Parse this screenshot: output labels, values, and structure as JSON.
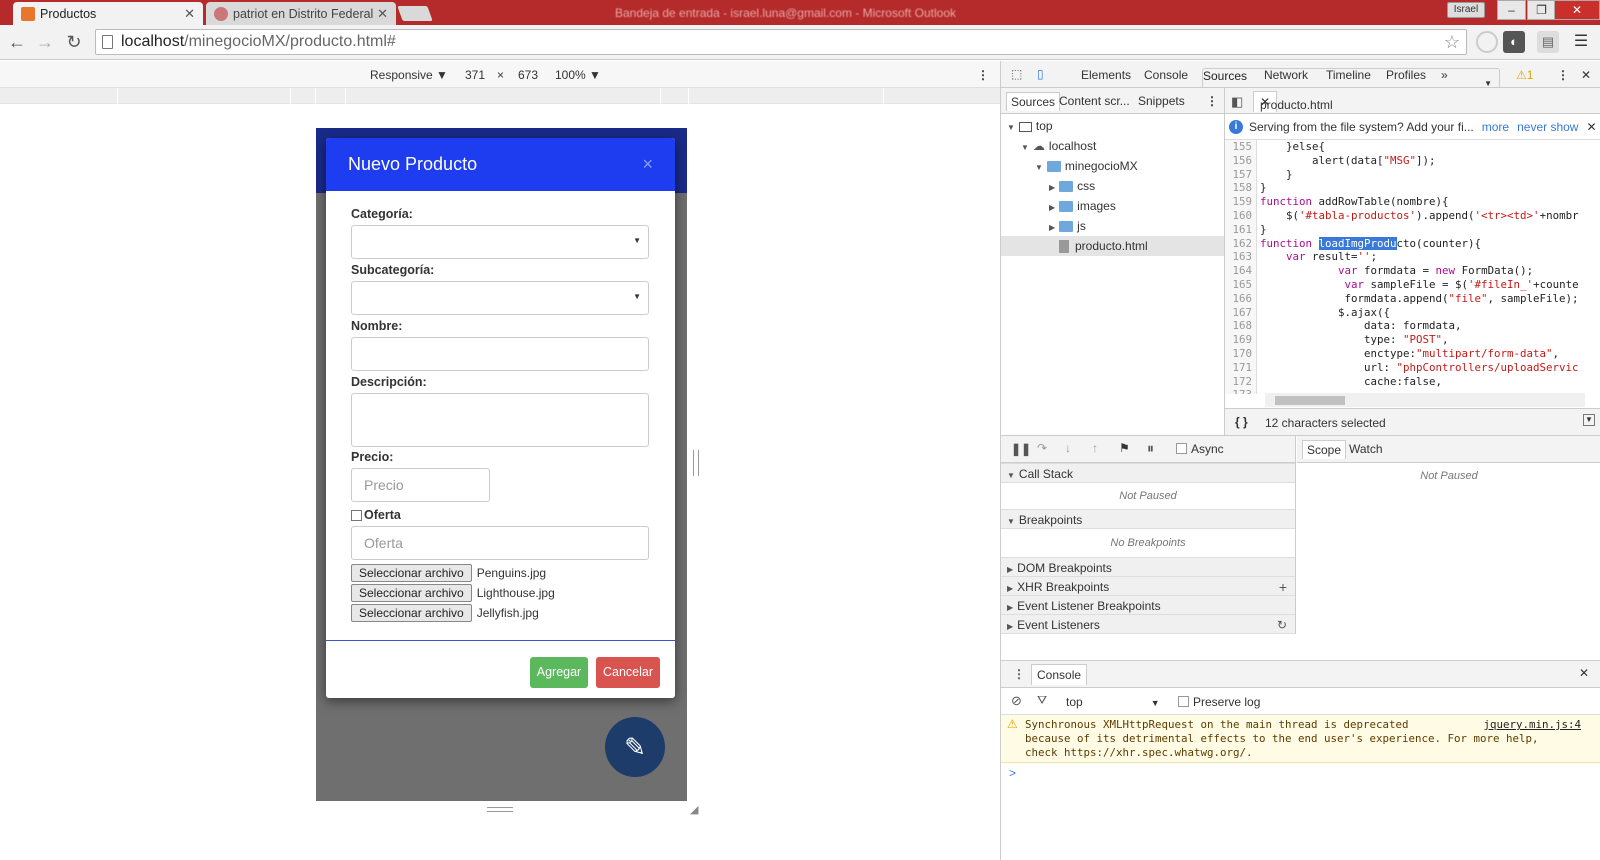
{
  "browser": {
    "tabs": [
      {
        "label": "Productos",
        "active": true
      },
      {
        "label": "patriot en Distrito Federal",
        "active": false
      }
    ],
    "window_title": "Bandeja de entrada - israel.luna@gmail.com - Microsoft Outlook",
    "profile": "Israel",
    "url_host": "localhost",
    "url_path": "/minegocioMX/producto.html#"
  },
  "device_toolbar": {
    "mode": "Responsive",
    "width": "371",
    "x": "×",
    "height": "673",
    "zoom": "100%"
  },
  "modal": {
    "title": "Nuevo Producto",
    "close": "×",
    "fields": {
      "categoria": "Categoría:",
      "subcategoria": "Subcategoría:",
      "nombre": "Nombre:",
      "descripcion": "Descripción:",
      "precio": "Precio:",
      "precio_placeholder": "Precio",
      "oferta": "Oferta",
      "oferta_placeholder": "Oferta"
    },
    "file_button": "Seleccionar archivo",
    "files": [
      "Penguins.jpg",
      "Lighthouse.jpg",
      "Jellyfish.jpg"
    ],
    "buttons": {
      "add": "Agregar",
      "cancel": "Cancelar"
    }
  },
  "devtools": {
    "tabs": [
      "Elements",
      "Console",
      "Sources",
      "Network",
      "Timeline",
      "Profiles"
    ],
    "selected_tab": "Sources",
    "warnings_count": "1",
    "nav_tabs": [
      "Sources",
      "Content scr...",
      "Snippets"
    ],
    "tree": {
      "top": "top",
      "host": "localhost",
      "project": "minegocioMX",
      "folders": [
        "css",
        "images",
        "js"
      ],
      "file": "producto.html"
    },
    "open_file": "producto.html",
    "infobar": {
      "text": "Serving from the file system? Add your fi...",
      "more": "more",
      "never": "never show"
    },
    "status": "12 characters selected",
    "debugger": {
      "async": "Async",
      "call_stack": "Call Stack",
      "not_paused": "Not Paused",
      "breakpoints": "Breakpoints",
      "no_breakpoints": "No Breakpoints",
      "dom_breakpoints": "DOM Breakpoints",
      "xhr_breakpoints": "XHR Breakpoints",
      "event_listener_breakpoints": "Event Listener Breakpoints",
      "event_listeners": "Event Listeners",
      "scope": "Scope",
      "watch": "Watch",
      "scope_not_paused": "Not Paused"
    },
    "console": {
      "tab": "Console",
      "context": "top",
      "preserve_log": "Preserve log",
      "warning_lines": [
        "Synchronous XMLHttpRequest on the main thread is deprecated",
        "because of its detrimental effects to the end user's experience. For more help,",
        "check https://xhr.spec.whatwg.org/."
      ],
      "warning_source": "jquery.min.js:4",
      "prompt": ">"
    }
  },
  "colors": {
    "titlebar": "#b52a2a",
    "modal_header": "#1e3cf0",
    "btn_green": "#5cb85c",
    "btn_red": "#d9534f",
    "fab": "#1d3c6a"
  }
}
